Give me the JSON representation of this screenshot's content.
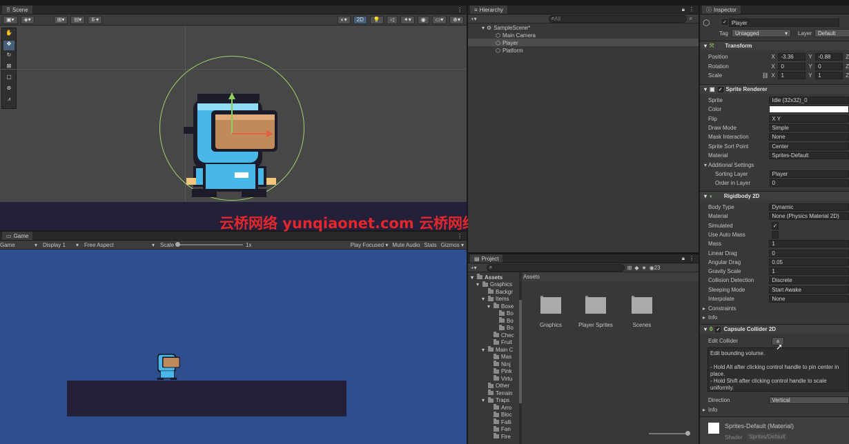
{
  "scene": {
    "tab": "Scene",
    "mode_2d": "2D"
  },
  "game": {
    "tab": "Game",
    "view": "Game",
    "display": "Display 1",
    "aspect": "Free Aspect",
    "scale_label": "Scale",
    "scale_value": "1x",
    "play_focused": "Play Focused",
    "mute": "Mute Audio",
    "stats": "Stats",
    "gizmos": "Gizmos"
  },
  "hierarchy": {
    "tab": "Hierarchy",
    "search_placeholder": "All",
    "scene_name": "SampleScene*",
    "items": [
      "Main Camera",
      "Player",
      "Platform"
    ]
  },
  "project": {
    "tab": "Project",
    "badge": "23",
    "tree": [
      {
        "label": "Assets",
        "depth": 0,
        "open": true
      },
      {
        "label": "Graphics",
        "depth": 1,
        "open": true
      },
      {
        "label": "Backgr",
        "depth": 2,
        "open": false
      },
      {
        "label": "Items",
        "depth": 2,
        "open": true
      },
      {
        "label": "Boxe",
        "depth": 3,
        "open": true
      },
      {
        "label": "Bo",
        "depth": 4,
        "open": false
      },
      {
        "label": "Bo",
        "depth": 4,
        "open": false
      },
      {
        "label": "Bo",
        "depth": 4,
        "open": false
      },
      {
        "label": "Chec",
        "depth": 3,
        "open": false
      },
      {
        "label": "Fruit",
        "depth": 3,
        "open": false
      },
      {
        "label": "Main C",
        "depth": 2,
        "open": true
      },
      {
        "label": "Mas",
        "depth": 3,
        "open": false
      },
      {
        "label": "Ninj",
        "depth": 3,
        "open": false
      },
      {
        "label": "Pink",
        "depth": 3,
        "open": false
      },
      {
        "label": "Virtu",
        "depth": 3,
        "open": false
      },
      {
        "label": "Other",
        "depth": 2,
        "open": false
      },
      {
        "label": "Terrain",
        "depth": 2,
        "open": false
      },
      {
        "label": "Traps",
        "depth": 2,
        "open": true
      },
      {
        "label": "Arro",
        "depth": 3,
        "open": false
      },
      {
        "label": "Bloc",
        "depth": 3,
        "open": false
      },
      {
        "label": "Falli",
        "depth": 3,
        "open": false
      },
      {
        "label": "Fan",
        "depth": 3,
        "open": false
      },
      {
        "label": "Fire",
        "depth": 3,
        "open": false
      }
    ],
    "assets_header": "Assets",
    "folders": [
      "Graphics",
      "Player Sprites",
      "Scenes"
    ]
  },
  "inspector": {
    "tab": "Inspector",
    "object_name": "Player",
    "tag_label": "Tag",
    "tag_value": "Untagged",
    "layer_label": "Layer",
    "layer_value": "Default",
    "transform": {
      "title": "Transform",
      "position_label": "Position",
      "pos_x": "-3.36",
      "pos_y": "-0.88",
      "rotation_label": "Rotation",
      "rot_x": "0",
      "rot_y": "0",
      "scale_label": "Scale",
      "scale_x": "1",
      "scale_y": "1"
    },
    "sprite_renderer": {
      "title": "Sprite Renderer",
      "rows": [
        {
          "label": "Sprite",
          "value": "Idle (32x32)_0"
        },
        {
          "label": "Color",
          "value": ""
        },
        {
          "label": "Flip",
          "value": "X      Y"
        },
        {
          "label": "Draw Mode",
          "value": "Simple"
        },
        {
          "label": "Mask Interaction",
          "value": "None"
        },
        {
          "label": "Sprite Sort Point",
          "value": "Center"
        },
        {
          "label": "Material",
          "value": "Sprites-Default"
        }
      ],
      "additional": "Additional Settings",
      "sorting_layer_label": "Sorting Layer",
      "sorting_layer_value": "Player",
      "order_label": "Order in Layer",
      "order_value": "0"
    },
    "rigidbody": {
      "title": "Rigidbody 2D",
      "rows": [
        {
          "label": "Body Type",
          "value": "Dynamic"
        },
        {
          "label": "Material",
          "value": "None (Physics Material 2D)"
        },
        {
          "label": "Simulated",
          "value": "✓"
        },
        {
          "label": "Use Auto Mass",
          "value": ""
        },
        {
          "label": "Mass",
          "value": "1"
        },
        {
          "label": "Linear Drag",
          "value": "0"
        },
        {
          "label": "Angular Drag",
          "value": "0.05"
        },
        {
          "label": "Gravity Scale",
          "value": "1"
        },
        {
          "label": "Collision Detection",
          "value": "Discrete"
        },
        {
          "label": "Sleeping Mode",
          "value": "Start Awake"
        },
        {
          "label": "Interpolate",
          "value": "None"
        }
      ],
      "constraints": "Constraints",
      "info": "Info"
    },
    "capsule": {
      "title": "Capsule Collider 2D",
      "edit_label": "Edit Collider",
      "tooltip_title": "Edit bounding volume.",
      "tooltip_l1": "- Hold Alt after clicking control handle to pin center in place.",
      "tooltip_l2": "- Hold Shift after clicking control handle to scale uniformly.",
      "direction_label": "Direction",
      "direction_value": "Vertical",
      "info": "Info"
    },
    "material_footer": {
      "name": "Sprites-Default (Material)",
      "shader_label": "Shader",
      "shader_value": "Sprites/Default"
    }
  },
  "watermark": "云桥网络 yunqiaonet.com 云桥网络 yunqiaowang.cn"
}
